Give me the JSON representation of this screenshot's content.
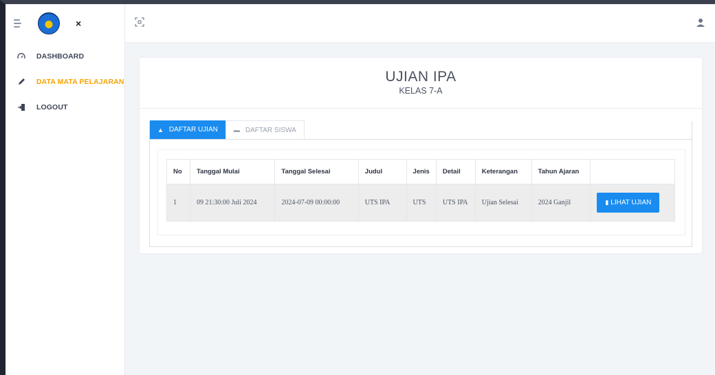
{
  "sidebar": {
    "close_symbol": "×",
    "items": [
      {
        "label": "DASHBOARD",
        "icon": "dashboard-icon",
        "active": false
      },
      {
        "label": "DATA MATA PELAJARAN",
        "icon": "pencil-icon",
        "active": true
      },
      {
        "label": "LOGOUT",
        "icon": "logout-icon",
        "active": false
      }
    ]
  },
  "card": {
    "title": "UJIAN IPA",
    "subtitle": "KELAS 7-A"
  },
  "tabs": [
    {
      "label": "DAFTAR UJIAN",
      "icon": "user-icon",
      "active": true
    },
    {
      "label": "DAFTAR SISWA",
      "icon": "list-icon",
      "active": false
    }
  ],
  "table": {
    "headers": [
      "No",
      "Tanggal Mulai",
      "Tanggal Selesai",
      "Judul",
      "Jenis",
      "Detail",
      "Keterangan",
      "Tahun Ajaran",
      ""
    ],
    "rows": [
      [
        "1",
        "09 21:30:00 Juli 2024",
        "2024-07-09 00:00:00",
        "UTS IPA",
        "UTS",
        "UTS IPA",
        "Ujian Selesai",
        "2024 Ganjil"
      ]
    ],
    "action_label": "LIHAT UJIAN"
  },
  "colors": {
    "accent": "#1a8cf0",
    "active_menu": "#f5a300"
  }
}
